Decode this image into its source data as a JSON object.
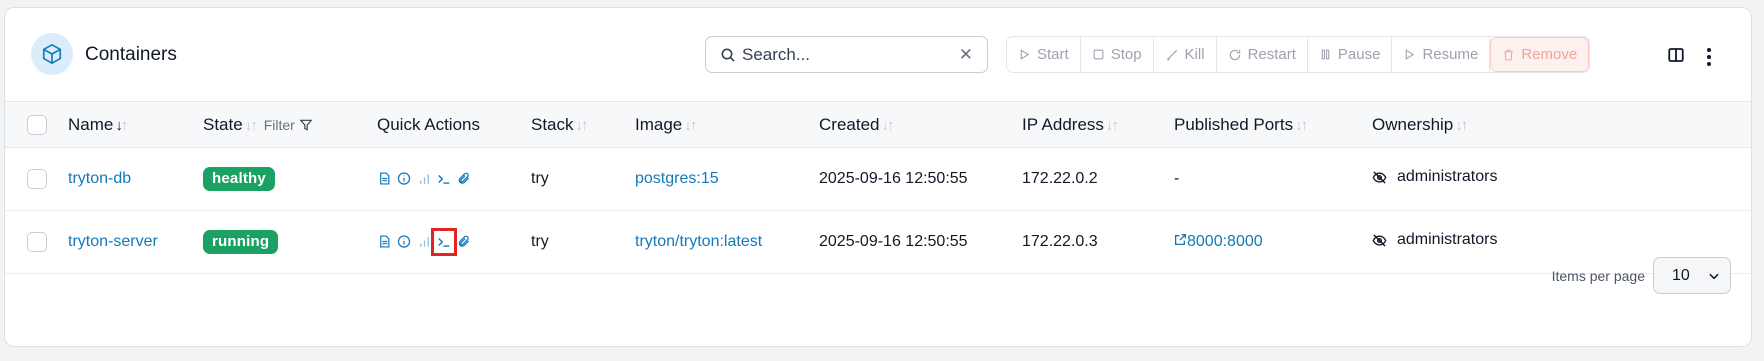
{
  "header": {
    "title": "Containers",
    "icon": "cube-icon",
    "search_placeholder": "Search...",
    "actions": [
      {
        "label": "Start",
        "icon": "play-icon"
      },
      {
        "label": "Stop",
        "icon": "stop-icon"
      },
      {
        "label": "Kill",
        "icon": "kill-icon"
      },
      {
        "label": "Restart",
        "icon": "restart-icon"
      },
      {
        "label": "Pause",
        "icon": "pause-icon"
      },
      {
        "label": "Resume",
        "icon": "play-icon"
      },
      {
        "label": "Remove",
        "icon": "trash-icon"
      }
    ]
  },
  "table": {
    "columns": {
      "name": "Name",
      "state": "State",
      "state_filter": "Filter",
      "quick_actions": "Quick Actions",
      "stack": "Stack",
      "image": "Image",
      "created": "Created",
      "ip": "IP Address",
      "ports": "Published Ports",
      "ownership": "Ownership"
    },
    "rows": [
      {
        "name": "tryton-db",
        "state": "healthy",
        "stack": "try",
        "image": "postgres:15",
        "created": "2025-09-16 12:50:55",
        "ip": "172.22.0.2",
        "ports": "-",
        "ownership": "administrators"
      },
      {
        "name": "tryton-server",
        "state": "running",
        "stack": "try",
        "image": "tryton/tryton:latest",
        "created": "2025-09-16 12:50:55",
        "ip": "172.22.0.3",
        "ports": "8000:8000",
        "ownership": "administrators"
      }
    ]
  },
  "footer": {
    "items_per_page_label": "Items per page",
    "items_per_page_value": "10"
  },
  "colors": {
    "accent": "#1379b9",
    "status_green": "#1aa163",
    "highlight": "#e02424"
  }
}
